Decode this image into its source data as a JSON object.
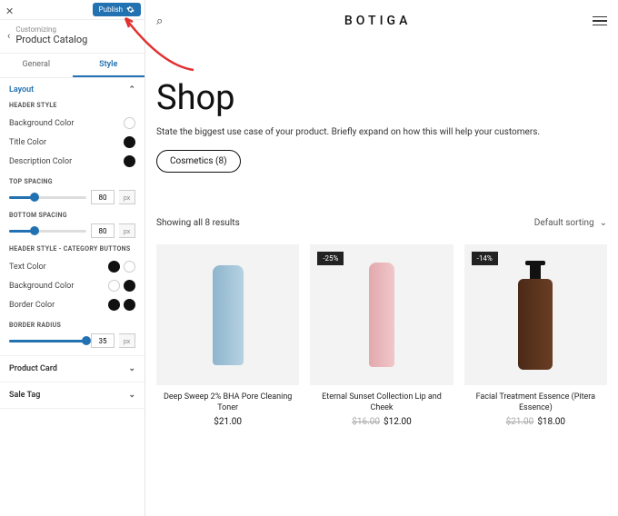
{
  "customizer": {
    "publish": "Publish",
    "customizing": "Customizing",
    "section_title": "Product Catalog",
    "tabs": {
      "general": "General",
      "style": "Style"
    },
    "layout": "Layout",
    "header_style": "HEADER STYLE",
    "bg_color": "Background Color",
    "title_color": "Title Color",
    "desc_color": "Description Color",
    "top_spacing": "TOP SPACING",
    "top_spacing_val": "80",
    "bottom_spacing": "BOTTOM SPACING",
    "bottom_spacing_val": "80",
    "header_style_cat": "HEADER STYLE - CATEGORY BUTTONS",
    "text_color": "Text Color",
    "border_color": "Border Color",
    "border_radius": "BORDER RADIUS",
    "border_radius_val": "35",
    "unit": "px",
    "product_card": "Product Card",
    "sale_tag": "Sale Tag"
  },
  "preview": {
    "brand": "BOTIGA",
    "shop_title": "Shop",
    "shop_sub": "State the biggest use case of your product. Briefly expand on how this will help your customers.",
    "cat_pill": "Cosmetics (8)",
    "results": "Showing all 8 results",
    "sort": "Default sorting",
    "products": [
      {
        "badge": "",
        "title": "Deep Sweep 2% BHA Pore Cleaning Toner",
        "old": "",
        "price": "$21.00"
      },
      {
        "badge": "-25%",
        "title": "Eternal Sunset Collection Lip and Cheek",
        "old": "$16.00",
        "price": "$12.00"
      },
      {
        "badge": "-14%",
        "title": "Facial Treatment Essence (Pitera Essence)",
        "old": "$21.00",
        "price": "$18.00"
      }
    ]
  }
}
